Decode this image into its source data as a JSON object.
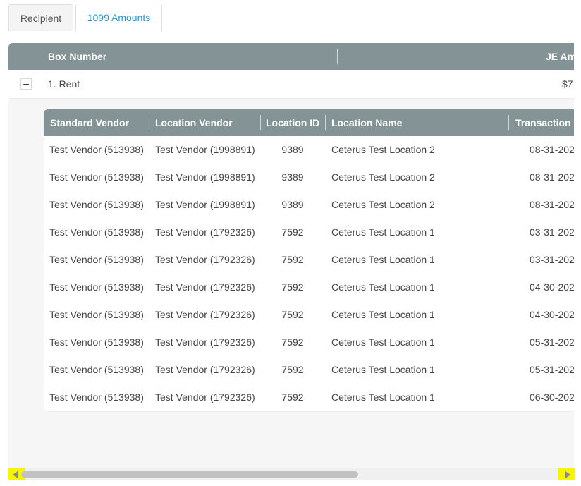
{
  "tabs": [
    {
      "label": "Recipient",
      "active": false
    },
    {
      "label": "1099 Amounts",
      "active": true
    }
  ],
  "colors": {
    "accent": "#1a9bd7",
    "header_bg": "#839396",
    "scroll_arrow_highlight": "#f5f500"
  },
  "outer_grid": {
    "headers": {
      "box_number": "Box Number",
      "je_amount": "JE Am"
    },
    "row": {
      "collapse_symbol": "–",
      "box_label": "1. Rent",
      "je_amount": "$7:"
    }
  },
  "detail_grid": {
    "headers": {
      "standard_vendor": "Standard Vendor",
      "location_vendor": "Location Vendor",
      "location_id": "Location ID",
      "location_name": "Location Name",
      "transaction": "Transaction I"
    },
    "rows": [
      {
        "standard_vendor": "Test Vendor (513938)",
        "location_vendor": "Test Vendor (1998891)",
        "location_id": "9389",
        "location_name": "Ceterus Test Location 2",
        "date": "08-31-202"
      },
      {
        "standard_vendor": "Test Vendor (513938)",
        "location_vendor": "Test Vendor (1998891)",
        "location_id": "9389",
        "location_name": "Ceterus Test Location 2",
        "date": "08-31-202"
      },
      {
        "standard_vendor": "Test Vendor (513938)",
        "location_vendor": "Test Vendor (1998891)",
        "location_id": "9389",
        "location_name": "Ceterus Test Location 2",
        "date": "08-31-202"
      },
      {
        "standard_vendor": "Test Vendor (513938)",
        "location_vendor": "Test Vendor (1792326)",
        "location_id": "7592",
        "location_name": "Ceterus Test Location 1",
        "date": "03-31-202"
      },
      {
        "standard_vendor": "Test Vendor (513938)",
        "location_vendor": "Test Vendor (1792326)",
        "location_id": "7592",
        "location_name": "Ceterus Test Location 1",
        "date": "03-31-202"
      },
      {
        "standard_vendor": "Test Vendor (513938)",
        "location_vendor": "Test Vendor (1792326)",
        "location_id": "7592",
        "location_name": "Ceterus Test Location 1",
        "date": "04-30-202"
      },
      {
        "standard_vendor": "Test Vendor (513938)",
        "location_vendor": "Test Vendor (1792326)",
        "location_id": "7592",
        "location_name": "Ceterus Test Location 1",
        "date": "04-30-202"
      },
      {
        "standard_vendor": "Test Vendor (513938)",
        "location_vendor": "Test Vendor (1792326)",
        "location_id": "7592",
        "location_name": "Ceterus Test Location 1",
        "date": "05-31-202"
      },
      {
        "standard_vendor": "Test Vendor (513938)",
        "location_vendor": "Test Vendor (1792326)",
        "location_id": "7592",
        "location_name": "Ceterus Test Location 1",
        "date": "05-31-202"
      },
      {
        "standard_vendor": "Test Vendor (513938)",
        "location_vendor": "Test Vendor (1792326)",
        "location_id": "7592",
        "location_name": "Ceterus Test Location 1",
        "date": "06-30-202"
      }
    ]
  },
  "scrollbar": {
    "left_icon": "scroll-left-icon",
    "right_icon": "scroll-right-icon"
  }
}
